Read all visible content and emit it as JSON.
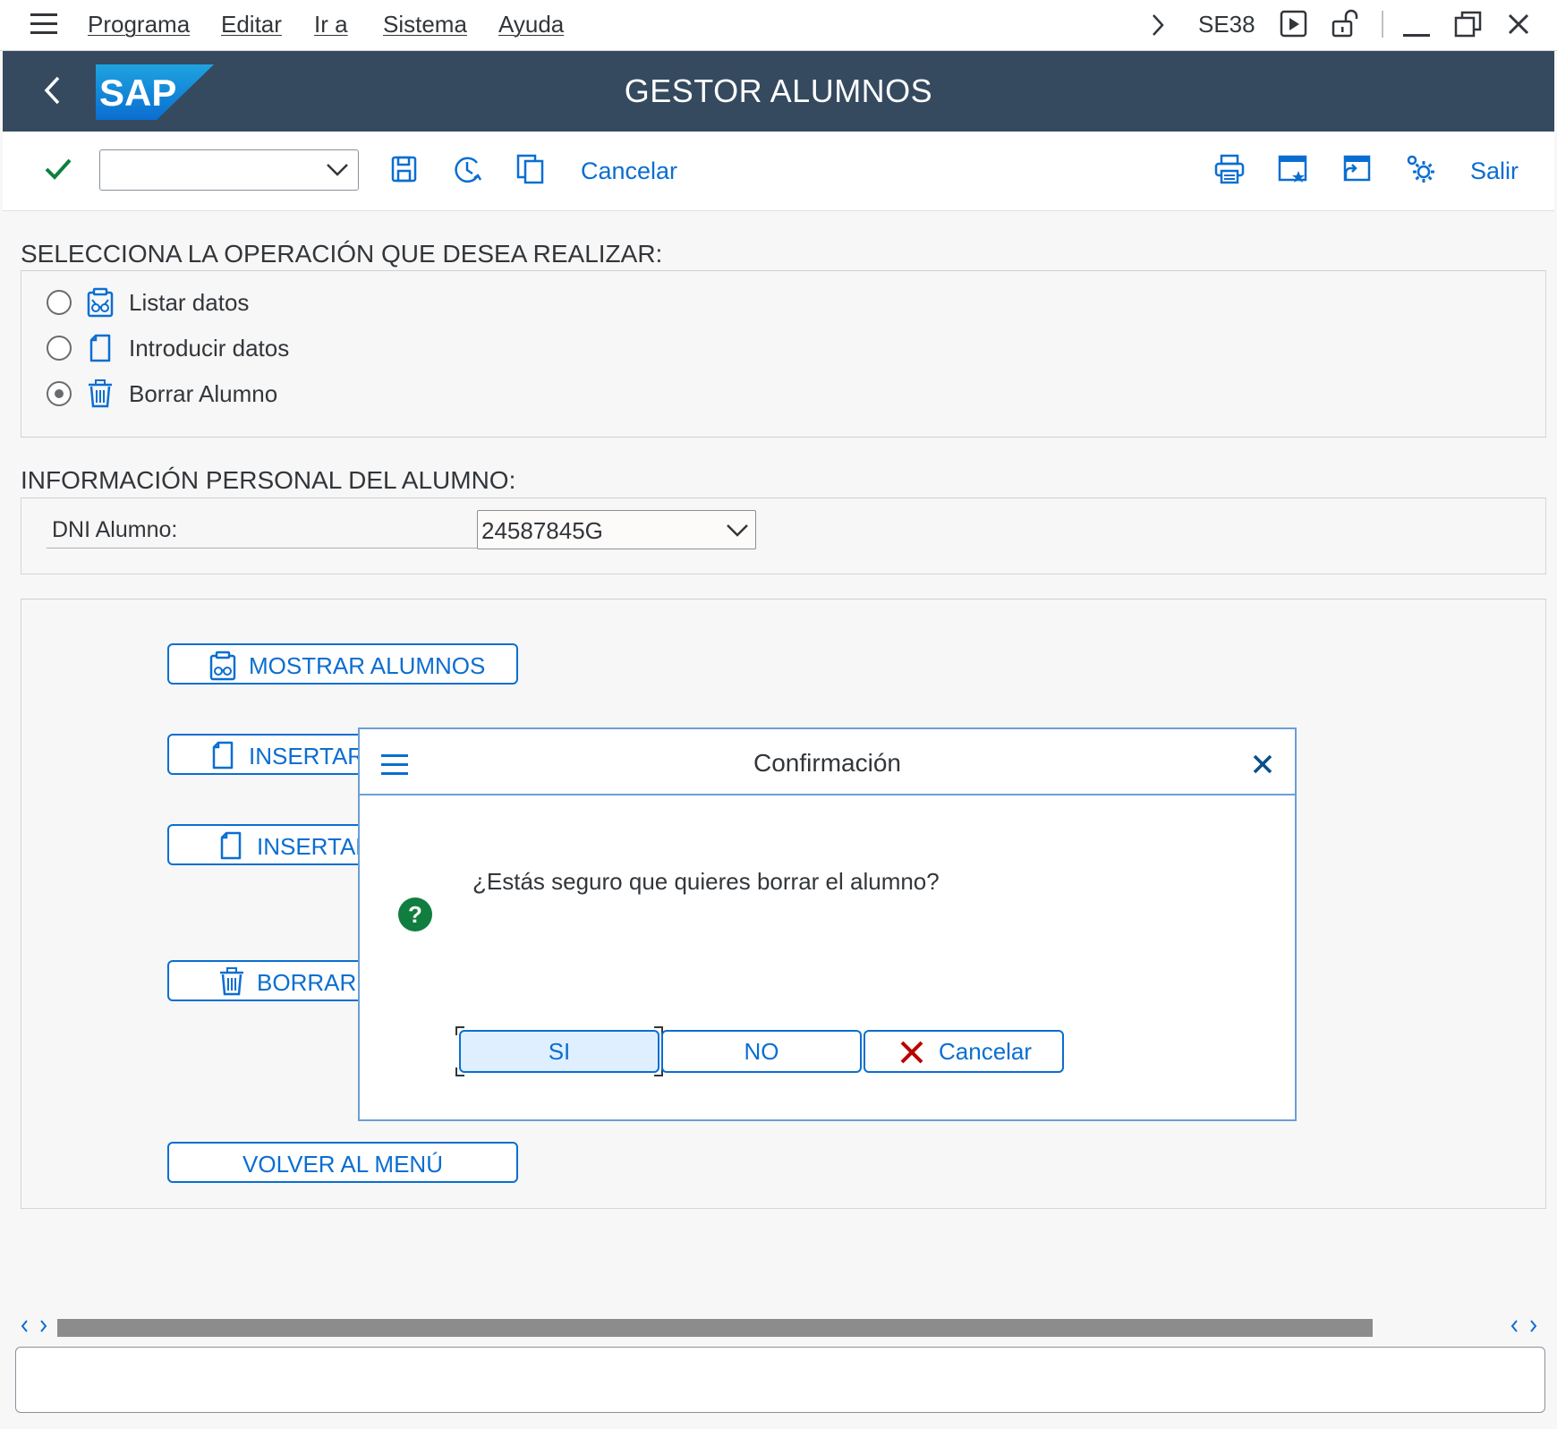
{
  "menubar": {
    "items": [
      "Programa",
      "Editar",
      "Ir a",
      "Sistema",
      "Ayuda"
    ],
    "transaction_code": "SE38"
  },
  "shell": {
    "title": "GESTOR ALUMNOS",
    "logo_text": "SAP"
  },
  "toolbar": {
    "command_field_value": "",
    "cancel_label": "Cancelar",
    "exit_label": "Salir"
  },
  "operation_section": {
    "title": "SELECCIONA LA OPERACIÓN QUE DESEA REALIZAR:",
    "options": [
      {
        "label": "Listar datos",
        "icon": "display-data-icon",
        "selected": false
      },
      {
        "label": "Introducir datos",
        "icon": "document-icon",
        "selected": false
      },
      {
        "label": "Borrar Alumno",
        "icon": "trash-icon",
        "selected": true
      }
    ]
  },
  "personal_section": {
    "title": "INFORMACIÓN PERSONAL DEL ALUMNO:",
    "dni_label": "DNI Alumno:",
    "dni_value": "24587845G"
  },
  "action_buttons": {
    "show": "MOSTRAR ALUMNOS",
    "insert1": "INSERTAR",
    "insert2": "INSERTAR",
    "delete": "BORRAR",
    "back": "VOLVER AL MENÚ"
  },
  "dialog": {
    "title": "Confirmación",
    "message": "¿Estás seguro que quieres borrar el alumno?",
    "yes_label": "SI",
    "no_label": "NO",
    "cancel_label": "Cancelar"
  },
  "statusbar": {
    "message": ""
  },
  "colors": {
    "shell_bg": "#354a5f",
    "accent": "#0a6ed1",
    "question_icon": "#107e3e",
    "cancel_x": "#bb0000"
  }
}
